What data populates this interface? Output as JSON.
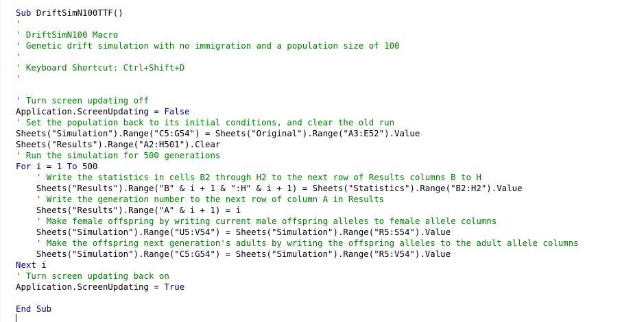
{
  "colors": {
    "keyword": "#00007f",
    "comment": "#007f00",
    "text": "#000000",
    "background": "#ffffff"
  },
  "code": {
    "lines": [
      {
        "indent": 0,
        "parts": [
          {
            "k": "kw",
            "t": "Sub"
          },
          {
            "k": "tx",
            "t": " DriftSimN100TTF()"
          }
        ]
      },
      {
        "indent": 0,
        "parts": [
          {
            "k": "cm",
            "t": "'"
          }
        ]
      },
      {
        "indent": 0,
        "parts": [
          {
            "k": "cm",
            "t": "' DriftSimN100 Macro"
          }
        ]
      },
      {
        "indent": 0,
        "parts": [
          {
            "k": "cm",
            "t": "' Genetic drift simulation with no immigration and a population size of 100"
          }
        ]
      },
      {
        "indent": 0,
        "parts": [
          {
            "k": "cm",
            "t": "'"
          }
        ]
      },
      {
        "indent": 0,
        "parts": [
          {
            "k": "cm",
            "t": "' Keyboard Shortcut: Ctrl+Shift+D"
          }
        ]
      },
      {
        "indent": 0,
        "parts": [
          {
            "k": "cm",
            "t": "'"
          }
        ]
      },
      {
        "indent": 0,
        "parts": []
      },
      {
        "indent": 0,
        "parts": [
          {
            "k": "cm",
            "t": "' Turn screen updating off"
          }
        ]
      },
      {
        "indent": 0,
        "parts": [
          {
            "k": "tx",
            "t": "Application.ScreenUpdating = "
          },
          {
            "k": "kw",
            "t": "False"
          }
        ]
      },
      {
        "indent": 0,
        "parts": [
          {
            "k": "cm",
            "t": "' Set the population back to its initial conditions, and clear the old run"
          }
        ]
      },
      {
        "indent": 0,
        "parts": [
          {
            "k": "tx",
            "t": "Sheets(\"Simulation\").Range(\"C5:G54\") = Sheets(\"Original\").Range(\"A3:E52\").Value"
          }
        ]
      },
      {
        "indent": 0,
        "parts": [
          {
            "k": "tx",
            "t": "Sheets(\"Results\").Range(\"A2:H501\").Clear"
          }
        ]
      },
      {
        "indent": 0,
        "parts": [
          {
            "k": "cm",
            "t": "' Run the simulation for 500 generations"
          }
        ]
      },
      {
        "indent": 0,
        "parts": [
          {
            "k": "kw",
            "t": "For"
          },
          {
            "k": "tx",
            "t": " i = 1 "
          },
          {
            "k": "kw",
            "t": "To"
          },
          {
            "k": "tx",
            "t": " 500"
          }
        ]
      },
      {
        "indent": 4,
        "parts": [
          {
            "k": "cm",
            "t": "' Write the statistics in cells B2 through H2 to the next row of Results columns B to H"
          }
        ]
      },
      {
        "indent": 4,
        "parts": [
          {
            "k": "tx",
            "t": "Sheets(\"Results\").Range(\"B\" & i + 1 & \":H\" & i + 1) = Sheets(\"Statistics\").Range(\"B2:H2\").Value"
          }
        ]
      },
      {
        "indent": 4,
        "parts": [
          {
            "k": "cm",
            "t": "' Write the generation number to the next row of column A in Results"
          }
        ]
      },
      {
        "indent": 4,
        "parts": [
          {
            "k": "tx",
            "t": "Sheets(\"Results\").Range(\"A\" & i + 1) = i"
          }
        ]
      },
      {
        "indent": 4,
        "parts": [
          {
            "k": "cm",
            "t": "' Make female offspring by writing current male offspring alleles to female allele columns"
          }
        ]
      },
      {
        "indent": 4,
        "parts": [
          {
            "k": "tx",
            "t": "Sheets(\"Simulation\").Range(\"U5:V54\") = Sheets(\"Simulation\").Range(\"R5:S54\").Value"
          }
        ]
      },
      {
        "indent": 4,
        "parts": [
          {
            "k": "cm",
            "t": "' Make the offspring next generation's adults by writing the offspring alleles to the adult allele columns"
          }
        ]
      },
      {
        "indent": 4,
        "parts": [
          {
            "k": "tx",
            "t": "Sheets(\"Simulation\").Range(\"C5:G54\") = Sheets(\"Simulation\").Range(\"R5:V54\").Value"
          }
        ]
      },
      {
        "indent": 0,
        "parts": [
          {
            "k": "kw",
            "t": "Next"
          },
          {
            "k": "tx",
            "t": " i"
          }
        ]
      },
      {
        "indent": 0,
        "parts": [
          {
            "k": "cm",
            "t": "' Turn screen updating back on"
          }
        ]
      },
      {
        "indent": 0,
        "parts": [
          {
            "k": "tx",
            "t": "Application.ScreenUpdating = "
          },
          {
            "k": "kw",
            "t": "True"
          }
        ]
      },
      {
        "indent": 0,
        "parts": []
      },
      {
        "indent": 0,
        "parts": [
          {
            "k": "kw",
            "t": "End Sub"
          }
        ]
      }
    ]
  }
}
